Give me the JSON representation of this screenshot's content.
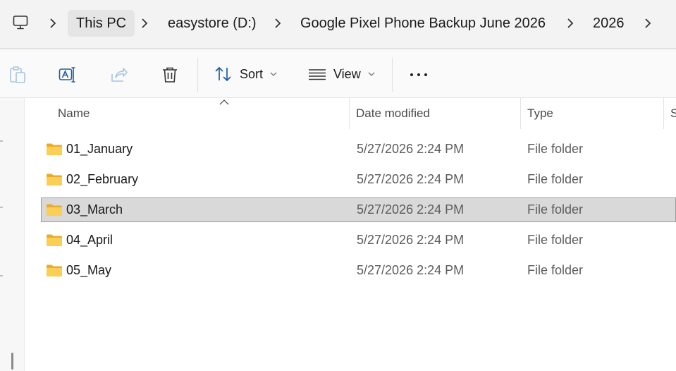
{
  "address_bar": {
    "crumbs": [
      "This PC",
      "easystore (D:)",
      "Google Pixel Phone Backup June 2026",
      "2026"
    ]
  },
  "command_bar": {
    "sort_label": "Sort",
    "view_label": "View"
  },
  "columns": {
    "name": "Name",
    "date": "Date modified",
    "type": "Type",
    "size": "S"
  },
  "files": [
    {
      "name": "01_January",
      "date": "5/27/2026 2:24 PM",
      "type": "File folder",
      "selected": false
    },
    {
      "name": "02_February",
      "date": "5/27/2026 2:24 PM",
      "type": "File folder",
      "selected": false
    },
    {
      "name": "03_March",
      "date": "5/27/2026 2:24 PM",
      "type": "File folder",
      "selected": true
    },
    {
      "name": "04_April",
      "date": "5/27/2026 2:24 PM",
      "type": "File folder",
      "selected": false
    },
    {
      "name": "05_May",
      "date": "5/27/2026 2:24 PM",
      "type": "File folder",
      "selected": false
    }
  ],
  "colors": {
    "folder": "#f8c94a",
    "selection": "#d9d9d9",
    "accent": "#005fb8"
  },
  "icons": [
    "computer-icon",
    "paste-icon",
    "rename-icon",
    "share-icon",
    "delete-icon",
    "sort-icon",
    "view-icon",
    "more-icon",
    "folder-icon"
  ]
}
